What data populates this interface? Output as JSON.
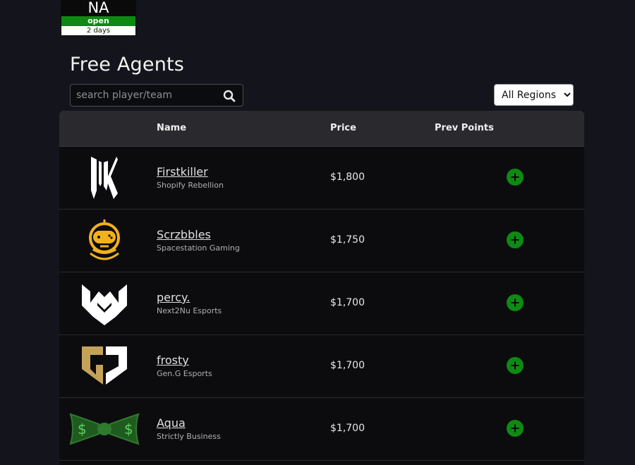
{
  "region_badge": {
    "code": "NA",
    "status": "open",
    "time": "2 days",
    "status_color": "#0e8a12"
  },
  "page": {
    "title": "Free Agents"
  },
  "search": {
    "placeholder": "search player/team",
    "value": ""
  },
  "region_filter": {
    "selected": "All Regions",
    "options": [
      "All Regions"
    ]
  },
  "table": {
    "headers": {
      "name": "Name",
      "price": "Price",
      "prev_points": "Prev Points"
    },
    "rows": [
      {
        "name": "Firstkiller",
        "team": "Shopify Rebellion",
        "price": "$1,800",
        "logo": "shopify-rebellion-logo"
      },
      {
        "name": "Scrzbbles",
        "team": "Spacestation Gaming",
        "price": "$1,750",
        "logo": "spacestation-logo"
      },
      {
        "name": "percy.",
        "team": "Next2Nu Esports",
        "price": "$1,700",
        "logo": "next2nu-logo"
      },
      {
        "name": "frosty",
        "team": "Gen.G Esports",
        "price": "$1,700",
        "logo": "geng-logo"
      },
      {
        "name": "Aqua",
        "team": "Strictly Business",
        "price": "$1,700",
        "logo": "strictly-business-logo"
      }
    ]
  },
  "colors": {
    "background": "#14151c",
    "accent_green": "#0e8a12",
    "header_bg": "#2a2a2e"
  }
}
